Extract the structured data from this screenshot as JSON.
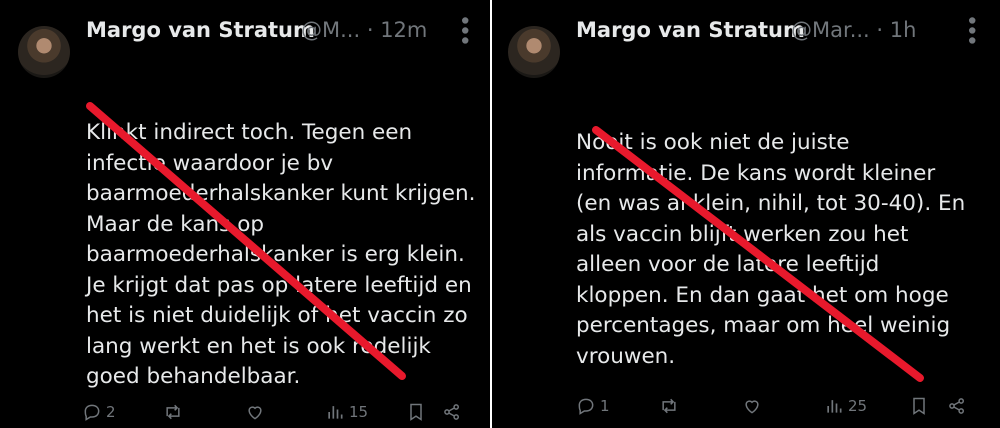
{
  "tweets": [
    {
      "author": "Margo van Stratum",
      "handle": "@M...",
      "time": "· 12m",
      "text": "Klinkt indirect toch. Tegen een\ninfectie waardoor je bv\nbaarmoederhalskanker kunt krijgen.\nMaar de kans op\nbaarmoederhalskanker is erg klein.\nJe krijgt dat pas op latere leeftijd en\nhet is niet duidelijk of het vaccin zo\nlang werkt en het is ook redelijk\ngoed behandelbaar.",
      "replies": "2",
      "views": "15"
    },
    {
      "author": "Margo van Stratum",
      "handle": "@Mar...",
      "time": "· 1h",
      "text": "Nooit is ook niet de juiste\ninformatie. De kans wordt kleiner\n(en was al klein, nihil, tot 30-40). En\nals vaccin blijft werken zou het\nalleen voor de latere leeftijd\nkloppen. En dan gaat het om hoge\npercentages, maar om heel weinig\nvrouwen.",
      "replies": "1",
      "views": "25"
    }
  ],
  "colors": {
    "strike": "#e8192c",
    "muted": "#71767b",
    "text": "#e7e9ea",
    "background": "#000000"
  },
  "icons": [
    "reply-icon",
    "retweet-icon",
    "like-icon",
    "views-icon",
    "bookmark-icon",
    "share-icon",
    "more-icon"
  ]
}
